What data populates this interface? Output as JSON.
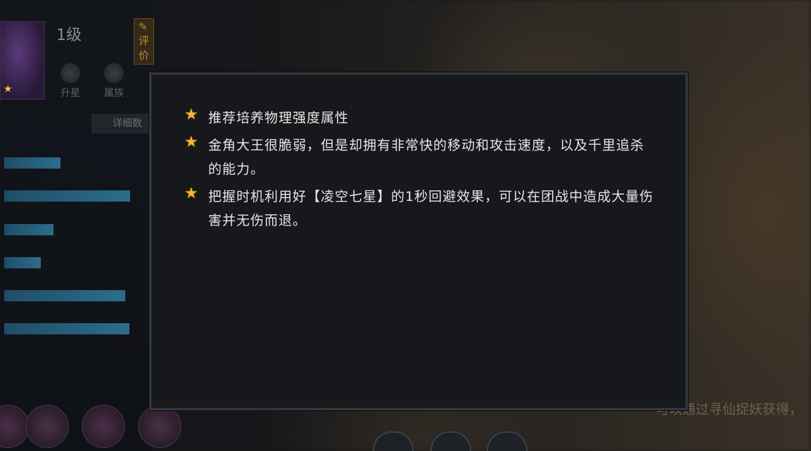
{
  "header": {
    "level": "1级",
    "rate_label": "评价"
  },
  "left_panel": {
    "buttons": [
      {
        "label": "升星"
      },
      {
        "label": "属族"
      }
    ],
    "detail_tab": "详细数",
    "stat_bars": [
      0.43,
      0.97,
      0.38,
      0.28,
      0.93,
      0.96
    ]
  },
  "background_text": "可以通过寻仙捉妖获得，",
  "dialog": {
    "tips": [
      {
        "icon": "star-icon",
        "text": "推荐培养物理强度属性"
      },
      {
        "icon": "star-icon",
        "text": "金角大王很脆弱，但是却拥有非常快的移动和攻击速度，以及千里追杀的能力。"
      },
      {
        "icon": "star-icon",
        "text": "把握时机利用好【凌空七星】的1秒回避效果，可以在团战中造成大量伤害并无伤而退。"
      }
    ]
  },
  "colors": {
    "star": "#f2b632",
    "dialog_bg": "#17181b",
    "dialog_border": "#34393f",
    "stat_bar": "#2c6d8c"
  }
}
